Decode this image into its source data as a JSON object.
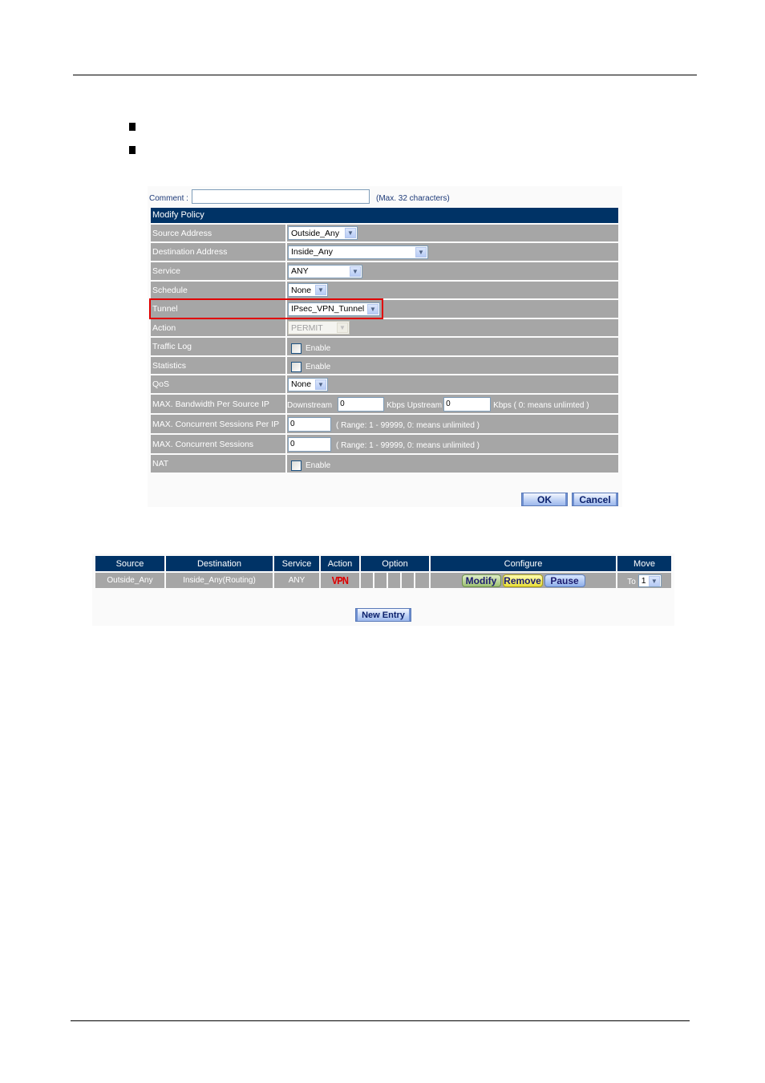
{
  "form": {
    "comment_label": "Comment :",
    "comment_value": "",
    "comment_hint": "(Max. 32 characters)",
    "title": "Modify Policy",
    "rows": {
      "source_address": {
        "label": "Source Address",
        "value": "Outside_Any"
      },
      "destination_address": {
        "label": "Destination Address",
        "value": "Inside_Any"
      },
      "service": {
        "label": "Service",
        "value": "ANY"
      },
      "schedule": {
        "label": "Schedule",
        "value": "None"
      },
      "tunnel": {
        "label": "Tunnel",
        "value": "IPsec_VPN_Tunnel"
      },
      "action": {
        "label": "Action",
        "value": "PERMIT"
      },
      "traffic_log": {
        "label": "Traffic Log",
        "checkbox_label": "Enable",
        "checked": false
      },
      "statistics": {
        "label": "Statistics",
        "checkbox_label": "Enable",
        "checked": false
      },
      "qos": {
        "label": "QoS",
        "value": "None"
      },
      "bandwidth": {
        "label": "MAX. Bandwidth Per Source IP",
        "downstream_label": "Downstream",
        "downstream_value": "0",
        "upstream_label": "Kbps Upstream",
        "upstream_value": "0",
        "hint": "Kbps ( 0: means unlimted )"
      },
      "sessions_per_ip": {
        "label": "MAX. Concurrent Sessions Per IP",
        "value": "0",
        "hint": "( Range: 1 - 99999, 0: means unlimited )"
      },
      "sessions": {
        "label": "MAX. Concurrent Sessions",
        "value": "0",
        "hint": "( Range: 1 - 99999, 0: means unlimited )"
      },
      "nat": {
        "label": "NAT",
        "checkbox_label": "Enable",
        "checked": false
      }
    },
    "ok_label": "OK",
    "cancel_label": "Cancel"
  },
  "policy_list": {
    "headers": {
      "source": "Source",
      "destination": "Destination",
      "service": "Service",
      "action": "Action",
      "option": "Option",
      "configure": "Configure",
      "move": "Move"
    },
    "rows": [
      {
        "source": "Outside_Any",
        "destination": "Inside_Any(Routing)",
        "service": "ANY",
        "action": "VPN",
        "modify_label": "Modify",
        "remove_label": "Remove",
        "pause_label": "Pause",
        "move_label": "To",
        "move_value": "1"
      }
    ],
    "new_entry_label": "New Entry"
  },
  "colors": {
    "header_bg": "#003366",
    "row_bg": "#a6a6a6",
    "highlight": "#e00000",
    "vpn": "#d40000"
  }
}
